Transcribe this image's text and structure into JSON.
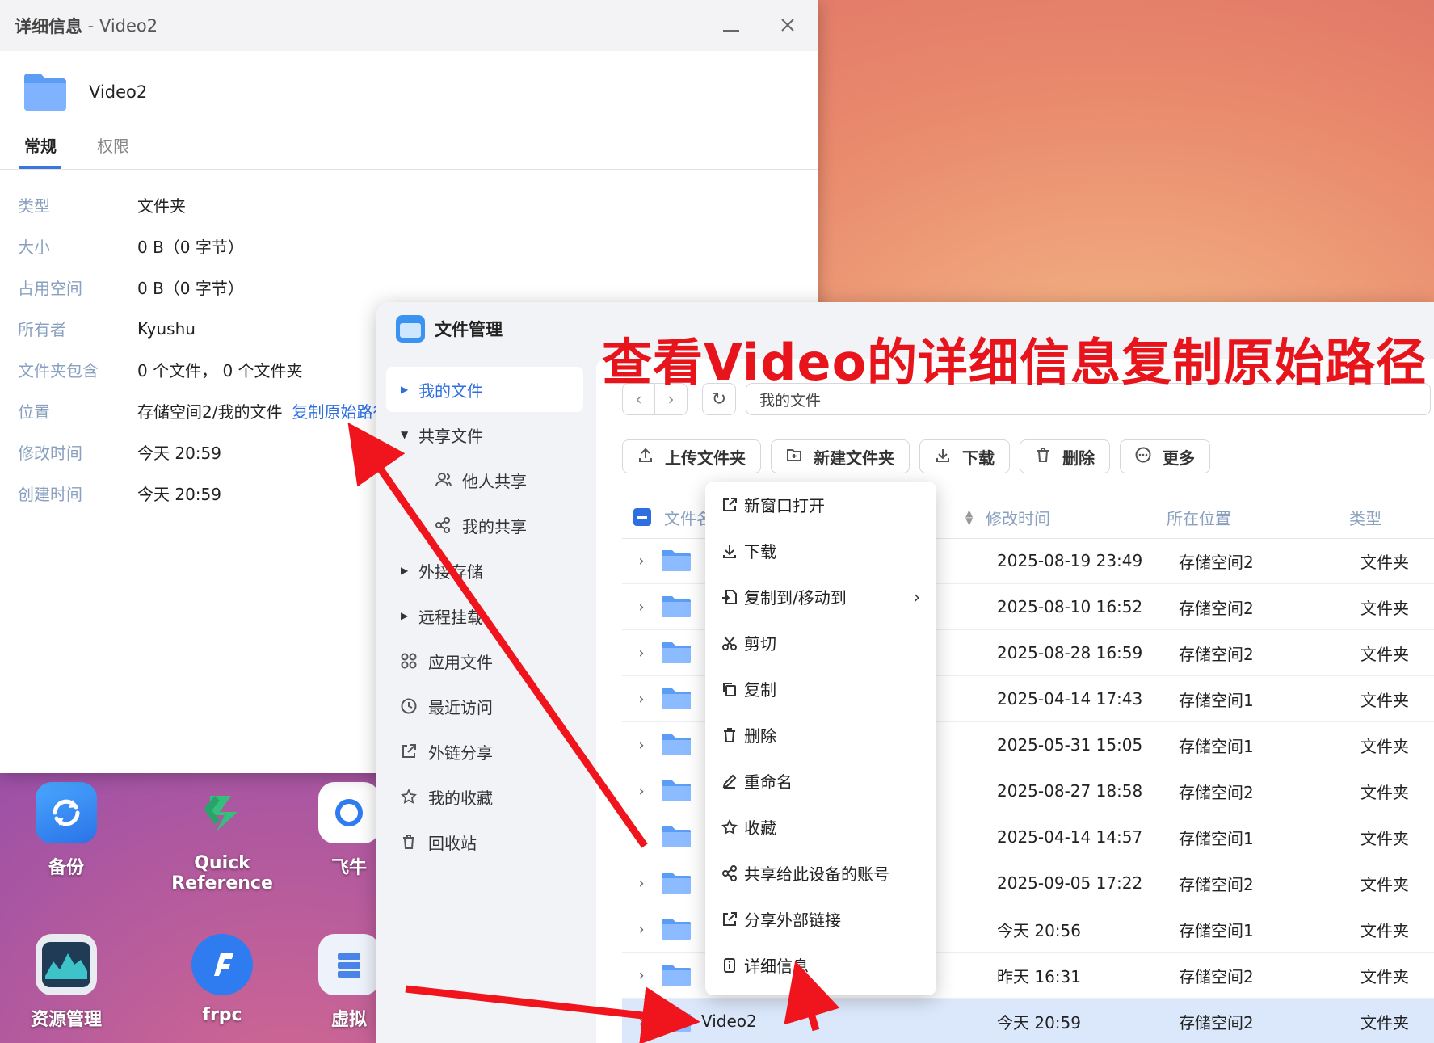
{
  "detail_window": {
    "title_main": "详细信息",
    "title_sep": " - ",
    "title_name": "Video2",
    "folder_name": "Video2",
    "tabs": [
      "常规",
      "权限"
    ],
    "props": [
      {
        "key": "类型",
        "value": "文件夹"
      },
      {
        "key": "大小",
        "value": "0 B（0 字节）"
      },
      {
        "key": "占用空间",
        "value": "0 B（0 字节）"
      },
      {
        "key": "所有者",
        "value": "Kyushu"
      },
      {
        "key": "文件夹包含",
        "value": "0 个文件， 0 个文件夹"
      },
      {
        "key": "位置",
        "value": "存储空间2/我的文件",
        "link": "复制原始路径"
      },
      {
        "key": "修改时间",
        "value": "今天 20:59"
      },
      {
        "key": "创建时间",
        "value": "今天 20:59"
      }
    ]
  },
  "desktop": {
    "icons": [
      {
        "label": "备份",
        "icon": "backup-icon",
        "color": "#2f8cf0"
      },
      {
        "label": "Quick Reference",
        "icon": "quick-reference-icon",
        "color": "#34c07a"
      },
      {
        "label": "飞牛",
        "icon": "feiniu-icon",
        "color": "#ffffff"
      },
      {
        "label": "资源管理",
        "icon": "resource-monitor-icon",
        "color": "#1f3b55"
      },
      {
        "label": "frpc",
        "icon": "frpc-icon",
        "color": "#2f7cf0"
      },
      {
        "label": "虚拟",
        "icon": "vm-icon",
        "color": "#eef2fa"
      }
    ]
  },
  "file_manager": {
    "app_title": "文件管理",
    "sidebar": [
      {
        "label": "我的文件",
        "icon": "caret-right",
        "selected": true
      },
      {
        "label": "共享文件",
        "icon": "caret-down"
      },
      {
        "label": "他人共享",
        "icon": "users-icon",
        "sub": true
      },
      {
        "label": "我的共享",
        "icon": "share-icon",
        "sub": true
      },
      {
        "label": "外接存储",
        "icon": "caret-right"
      },
      {
        "label": "远程挂载",
        "icon": "caret-right"
      },
      {
        "label": "应用文件",
        "icon": "apps-icon"
      },
      {
        "label": "最近访问",
        "icon": "clock-icon"
      },
      {
        "label": "外链分享",
        "icon": "external-share-icon"
      },
      {
        "label": "我的收藏",
        "icon": "star-icon"
      },
      {
        "label": "回收站",
        "icon": "trash-icon"
      }
    ],
    "path": "我的文件",
    "toolbar": [
      {
        "label": "上传文件夹",
        "icon": "upload-icon"
      },
      {
        "label": "新建文件夹",
        "icon": "new-folder-icon"
      },
      {
        "label": "下载",
        "icon": "download-icon"
      },
      {
        "label": "删除",
        "icon": "trash-icon"
      },
      {
        "label": "更多",
        "icon": "more-icon"
      }
    ],
    "columns": {
      "name": "文件名",
      "mtime": "修改时间",
      "location": "所在位置",
      "type": "类型"
    },
    "rows": [
      {
        "name": "",
        "mtime": "2025-08-19 23:49",
        "location": "存储空间2",
        "type": "文件夹"
      },
      {
        "name": "",
        "mtime": "2025-08-10 16:52",
        "location": "存储空间2",
        "type": "文件夹"
      },
      {
        "name": "",
        "mtime": "2025-08-28 16:59",
        "location": "存储空间2",
        "type": "文件夹"
      },
      {
        "name": "",
        "mtime": "2025-04-14 17:43",
        "location": "存储空间1",
        "type": "文件夹"
      },
      {
        "name": "",
        "mtime": "2025-05-31 15:05",
        "location": "存储空间1",
        "type": "文件夹"
      },
      {
        "name": "",
        "mtime": "2025-08-27 18:58",
        "location": "存储空间2",
        "type": "文件夹"
      },
      {
        "name": "",
        "mtime": "2025-04-14 14:57",
        "location": "存储空间1",
        "type": "文件夹"
      },
      {
        "name": "",
        "mtime": "2025-09-05 17:22",
        "location": "存储空间2",
        "type": "文件夹"
      },
      {
        "name": "",
        "mtime": "今天 20:56",
        "location": "存储空间1",
        "type": "文件夹"
      },
      {
        "name": "",
        "mtime": "昨天 16:31",
        "location": "存储空间2",
        "type": "文件夹"
      },
      {
        "name": "Video2",
        "mtime": "今天 20:59",
        "location": "存储空间2",
        "type": "文件夹",
        "selected": true
      }
    ],
    "context_menu": [
      {
        "label": "新窗口打开",
        "icon": "open-new-window-icon"
      },
      {
        "label": "下载",
        "icon": "download-icon"
      },
      {
        "label": "复制到/移动到",
        "icon": "copy-move-icon",
        "submenu": true
      },
      {
        "label": "剪切",
        "icon": "scissors-icon"
      },
      {
        "label": "复制",
        "icon": "copy-icon"
      },
      {
        "label": "删除",
        "icon": "trash-icon"
      },
      {
        "label": "重命名",
        "icon": "pencil-icon"
      },
      {
        "label": "收藏",
        "icon": "star-icon"
      },
      {
        "label": "共享给此设备的账号",
        "icon": "share-icon"
      },
      {
        "label": "分享外部链接",
        "icon": "external-share-icon"
      },
      {
        "label": "详细信息",
        "icon": "info-icon"
      }
    ]
  },
  "annotation": {
    "text": "查看Video的详细信息复制原始路径",
    "color": "#e8141c"
  }
}
